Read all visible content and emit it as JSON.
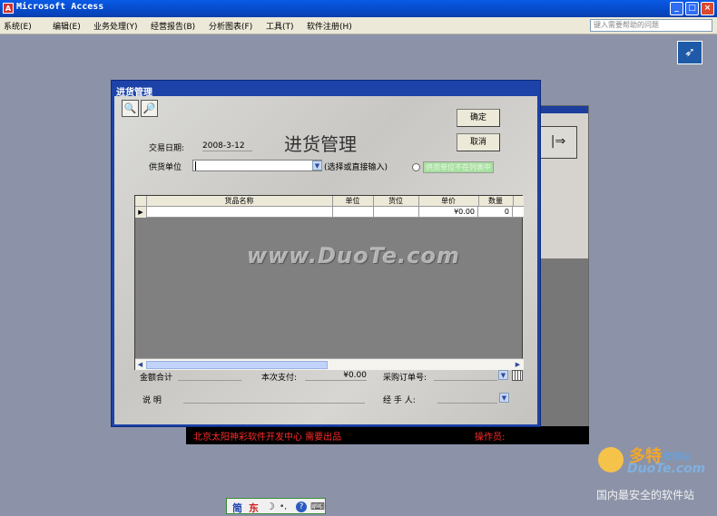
{
  "app": {
    "title": "Microsoft Access",
    "icon": "access-key-icon"
  },
  "window_controls": {
    "minimize": "_",
    "maximize": "□",
    "close": "×"
  },
  "menubar": {
    "items": [
      "系统(E)",
      "编辑(E)",
      "业务处理(Y)",
      "经营报告(B)",
      "分析图表(F)",
      "工具(T)",
      "软件注册(H)"
    ],
    "help_placeholder": "键入需要帮助的问题"
  },
  "background_form": {
    "toolbar_glyph": "|⇒",
    "status_left": "北京太阳神彩软件开发中心   需要出品",
    "status_right": "操作员:"
  },
  "dialog": {
    "title": "进货管理",
    "heading": "进货管理",
    "confirm_label": "确定",
    "cancel_label": "取消",
    "tool_icons": {
      "preview": "🔍",
      "find": "🔎"
    },
    "date_label": "交易日期:",
    "date_value": "2008-3-12",
    "supplier_label": "供货单位",
    "supplier_value": "",
    "supplier_hint": "(选择或直接输入)",
    "radio_label": "供货单位不在列表中",
    "grid": {
      "columns": [
        "货品名称",
        "单位",
        "货位",
        "单价",
        "数量"
      ],
      "rows": [
        {
          "name": "",
          "unit": "",
          "location": "",
          "price": "¥0.00",
          "qty": "0"
        }
      ]
    },
    "total_label": "金额合计",
    "payment_label": "本次支付:",
    "payment_value": "¥0.00",
    "po_label": "采购订单号:",
    "po_value": "",
    "note_label": "说      明",
    "note_value": "",
    "handler_label": "经  手  人:",
    "handler_value": ""
  },
  "ime": {
    "mode1": "简",
    "mode2": "东",
    "moon": "☽",
    "punct": "•,",
    "help": "?",
    "keyboard": "⌨"
  },
  "watermark": {
    "center": "www.DuoTe.com",
    "logo_big": "多特",
    "logo_small": "软件站",
    "logo_url": "DuoTe.com",
    "logo_slogan": "国内最安全的软件站"
  },
  "colors": {
    "titlebar": "#0549c8",
    "dialog_frame": "#1d43a8",
    "desktop": "#8c93a8",
    "status_text": "#ff2a2a"
  }
}
